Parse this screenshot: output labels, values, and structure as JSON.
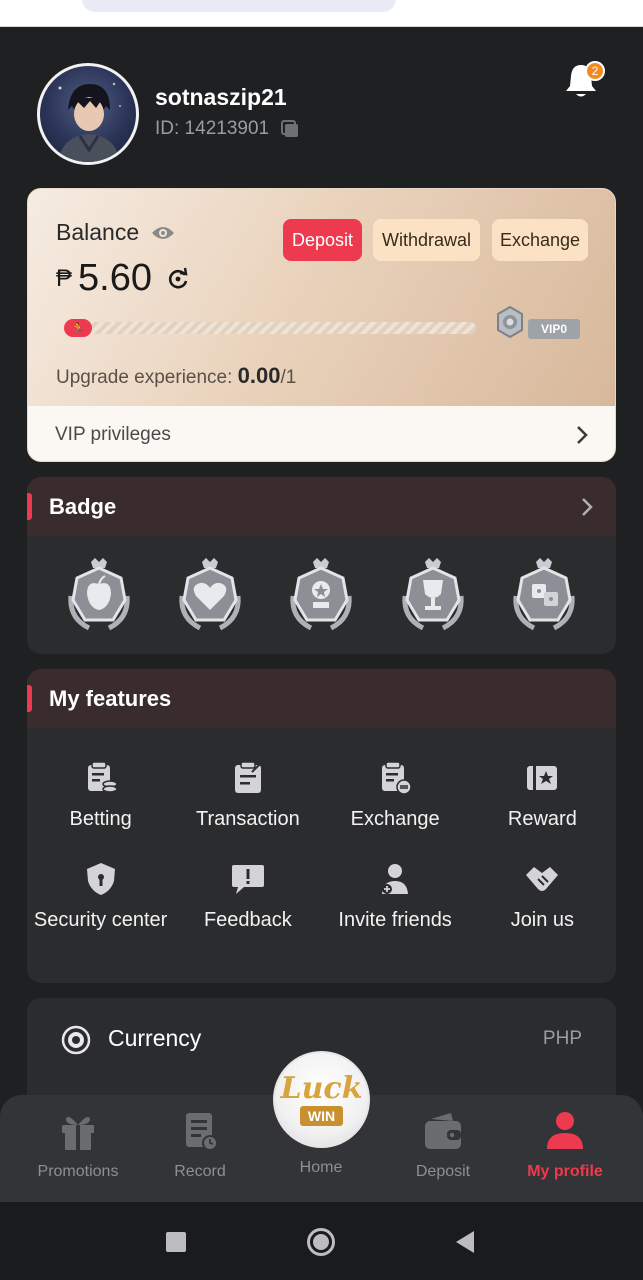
{
  "profile": {
    "username": "sotnaszip21",
    "id_text": "ID: 14213901",
    "notification_count": "2"
  },
  "balance": {
    "label": "Balance",
    "currency_symbol": "₱",
    "amount": "5.60",
    "buttons": {
      "deposit": "Deposit",
      "withdrawal": "Withdrawal",
      "exchange": "Exchange"
    },
    "vip_level": "VIP0",
    "upgrade_label": "Upgrade experience:",
    "upgrade_current": "0.00",
    "upgrade_target": "/1",
    "upgrade_progress": 0,
    "vip_privileges": "VIP privileges"
  },
  "badge_section": {
    "title": "Badge",
    "badges": [
      "apple-badge",
      "heart-badge",
      "trophy-star-badge",
      "cup-badge",
      "dice-badge"
    ]
  },
  "features_section": {
    "title": "My features",
    "items": [
      {
        "label": "Betting",
        "icon": "betting-icon"
      },
      {
        "label": "Transaction",
        "icon": "transaction-icon"
      },
      {
        "label": "Exchange",
        "icon": "exchange-icon"
      },
      {
        "label": "Reward",
        "icon": "reward-icon"
      },
      {
        "label": "Security center",
        "icon": "shield-icon"
      },
      {
        "label": "Feedback",
        "icon": "feedback-icon"
      },
      {
        "label": "Invite friends",
        "icon": "invite-icon"
      },
      {
        "label": "Join us",
        "icon": "handshake-icon"
      }
    ]
  },
  "currency": {
    "label": "Currency",
    "value": "PHP"
  },
  "bottom_nav": {
    "promotions": "Promotions",
    "record": "Record",
    "home": "Home",
    "deposit": "Deposit",
    "my_profile": "My profile",
    "logo_top": "Luck",
    "logo_bottom": "WIN"
  },
  "colors": {
    "accent": "#ee3a4e",
    "background": "#1f2022",
    "card": "#2b2c2e"
  }
}
